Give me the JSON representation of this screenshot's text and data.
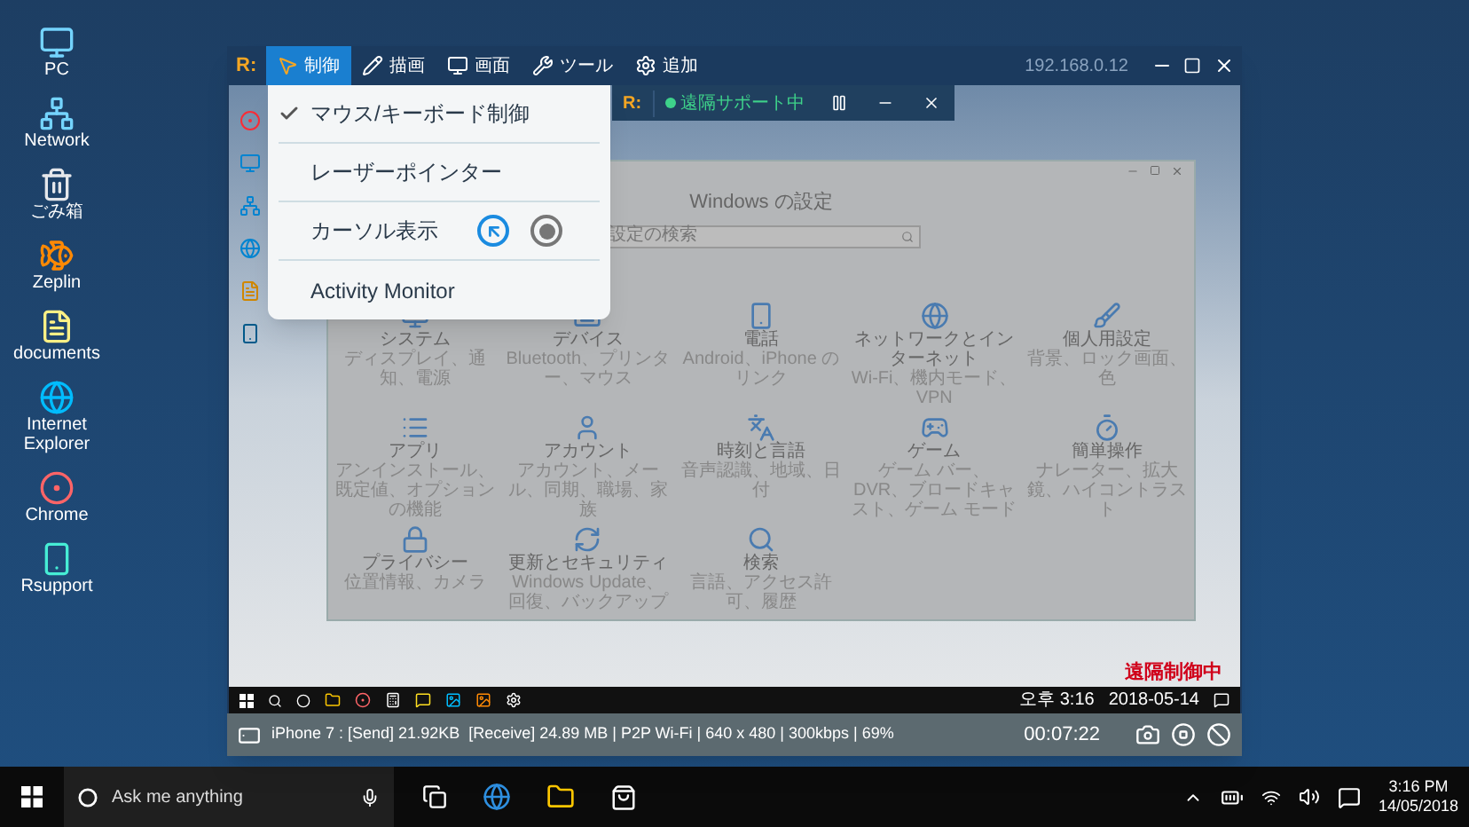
{
  "desktop_icons": [
    {
      "label": "PC"
    },
    {
      "label": "Network"
    },
    {
      "label": "ごみ箱"
    },
    {
      "label": "Zeplin"
    },
    {
      "label": "documents"
    },
    {
      "label": "Internet Explorer"
    },
    {
      "label": "Chrome"
    },
    {
      "label": "Rsupport"
    }
  ],
  "app": {
    "logo": "R:",
    "tabs": [
      {
        "label": "制御",
        "selected": true
      },
      {
        "label": "描画",
        "selected": false
      },
      {
        "label": "画面",
        "selected": false
      },
      {
        "label": "ツール",
        "selected": false
      },
      {
        "label": "追加",
        "selected": false
      }
    ],
    "address": "192.168.0.12",
    "menu": [
      {
        "kind": "check",
        "label": "マウス/キーボード制御",
        "checked": true
      },
      {
        "kind": "check",
        "label": "レーザーポインター",
        "checked": false
      },
      {
        "kind": "cursor",
        "label": "カーソル表示",
        "options": [
          {
            "selected": true
          },
          {
            "selected": false
          }
        ]
      },
      {
        "kind": "check",
        "label": "Activity Monitor",
        "checked": false
      }
    ],
    "remote_toolbar": {
      "logo": "R:",
      "status": "遠隔サポート中"
    },
    "remote_screen": {
      "settings": {
        "title": "Windows の設定",
        "search_placeholder": "設定の検索",
        "items": [
          {
            "title": "システム",
            "subtitle": "ディスプレイ、通知、電源"
          },
          {
            "title": "デバイス",
            "subtitle": "Bluetooth、プリンター、マウス"
          },
          {
            "title": "電話",
            "subtitle": "Android、iPhone のリンク"
          },
          {
            "title": "ネットワークとインターネット",
            "subtitle": "Wi-Fi、機内モード、VPN"
          },
          {
            "title": "個人用設定",
            "subtitle": "背景、ロック画面、色"
          },
          {
            "title": "アプリ",
            "subtitle": "アンインストール、既定値、オプションの機能"
          },
          {
            "title": "アカウント",
            "subtitle": "アカウント、メール、同期、職場、家族"
          },
          {
            "title": "時刻と言語",
            "subtitle": "音声認識、地域、日付"
          },
          {
            "title": "ゲーム",
            "subtitle": "ゲーム バー、DVR、ブロードキャスト、ゲーム モード"
          },
          {
            "title": "簡単操作",
            "subtitle": "ナレーター、拡大鏡、ハイコントラスト"
          },
          {
            "title": "プライバシー",
            "subtitle": "位置情報、カメラ"
          },
          {
            "title": "更新とセキュリティ",
            "subtitle": "Windows Update、回復、バックアップ"
          },
          {
            "title": "検索",
            "subtitle": "言語、アクセス許可、履歴"
          }
        ]
      },
      "overlay_text": "遠隔制御中",
      "taskbar_time": "오후 3:16",
      "taskbar_date": "2018-05-14"
    },
    "status_bar": {
      "info": "iPhone 7 : [Send] 21.92KB  [Receive] 24.89 MB | P2P Wi-Fi | 640 x 480 | 300kbps | 69%",
      "elapsed": "00:07:22"
    }
  },
  "taskbar": {
    "search_placeholder": "Ask me anything",
    "time": "3:16 PM",
    "date": "14/05/2018"
  }
}
